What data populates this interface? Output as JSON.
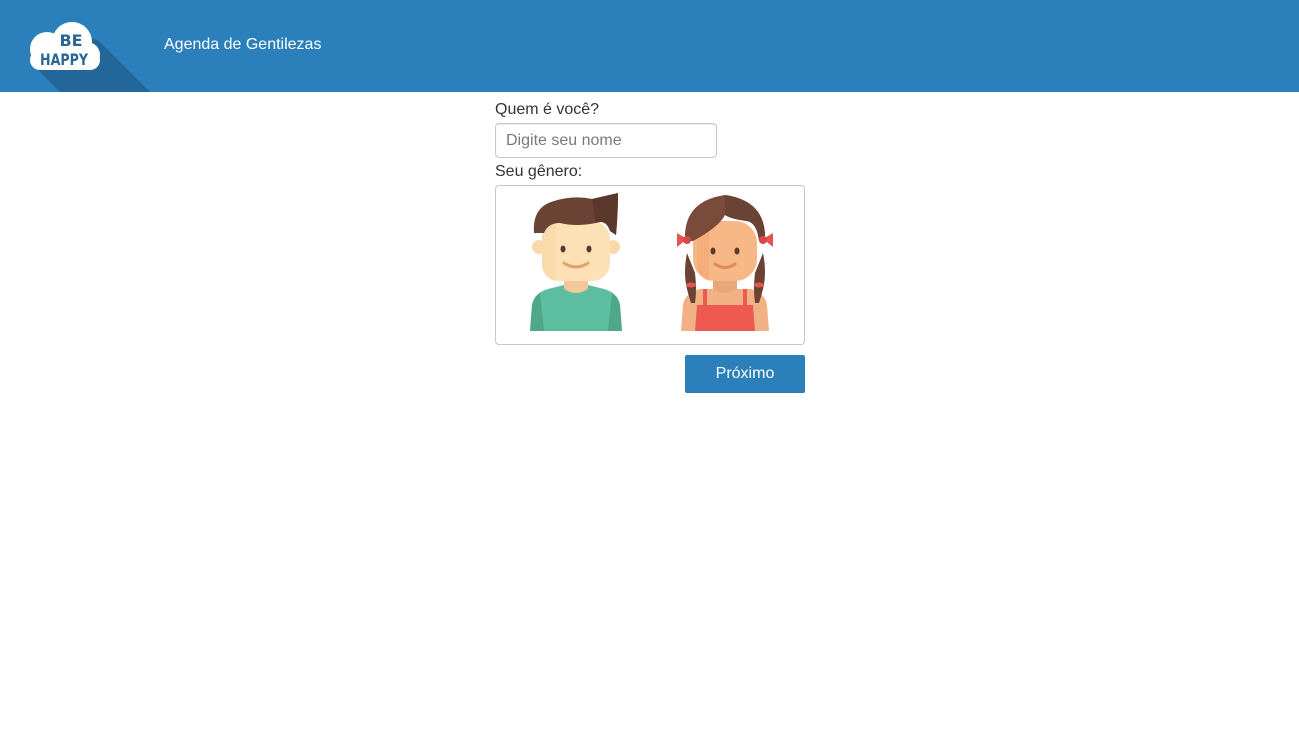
{
  "header": {
    "logo_text": "BE HAPPY",
    "title": "Agenda de Gentilezas"
  },
  "form": {
    "name_label": "Quem é você?",
    "name_placeholder": "Digite seu nome",
    "name_value": "",
    "gender_label": "Seu gênero:",
    "gender_options": [
      {
        "icon": "boy-avatar-icon"
      },
      {
        "icon": "girl-avatar-icon"
      }
    ],
    "next_label": "Próximo"
  },
  "colors": {
    "header_bg": "#2b7fba",
    "button_bg": "#2b7fba",
    "text": "#333333"
  }
}
